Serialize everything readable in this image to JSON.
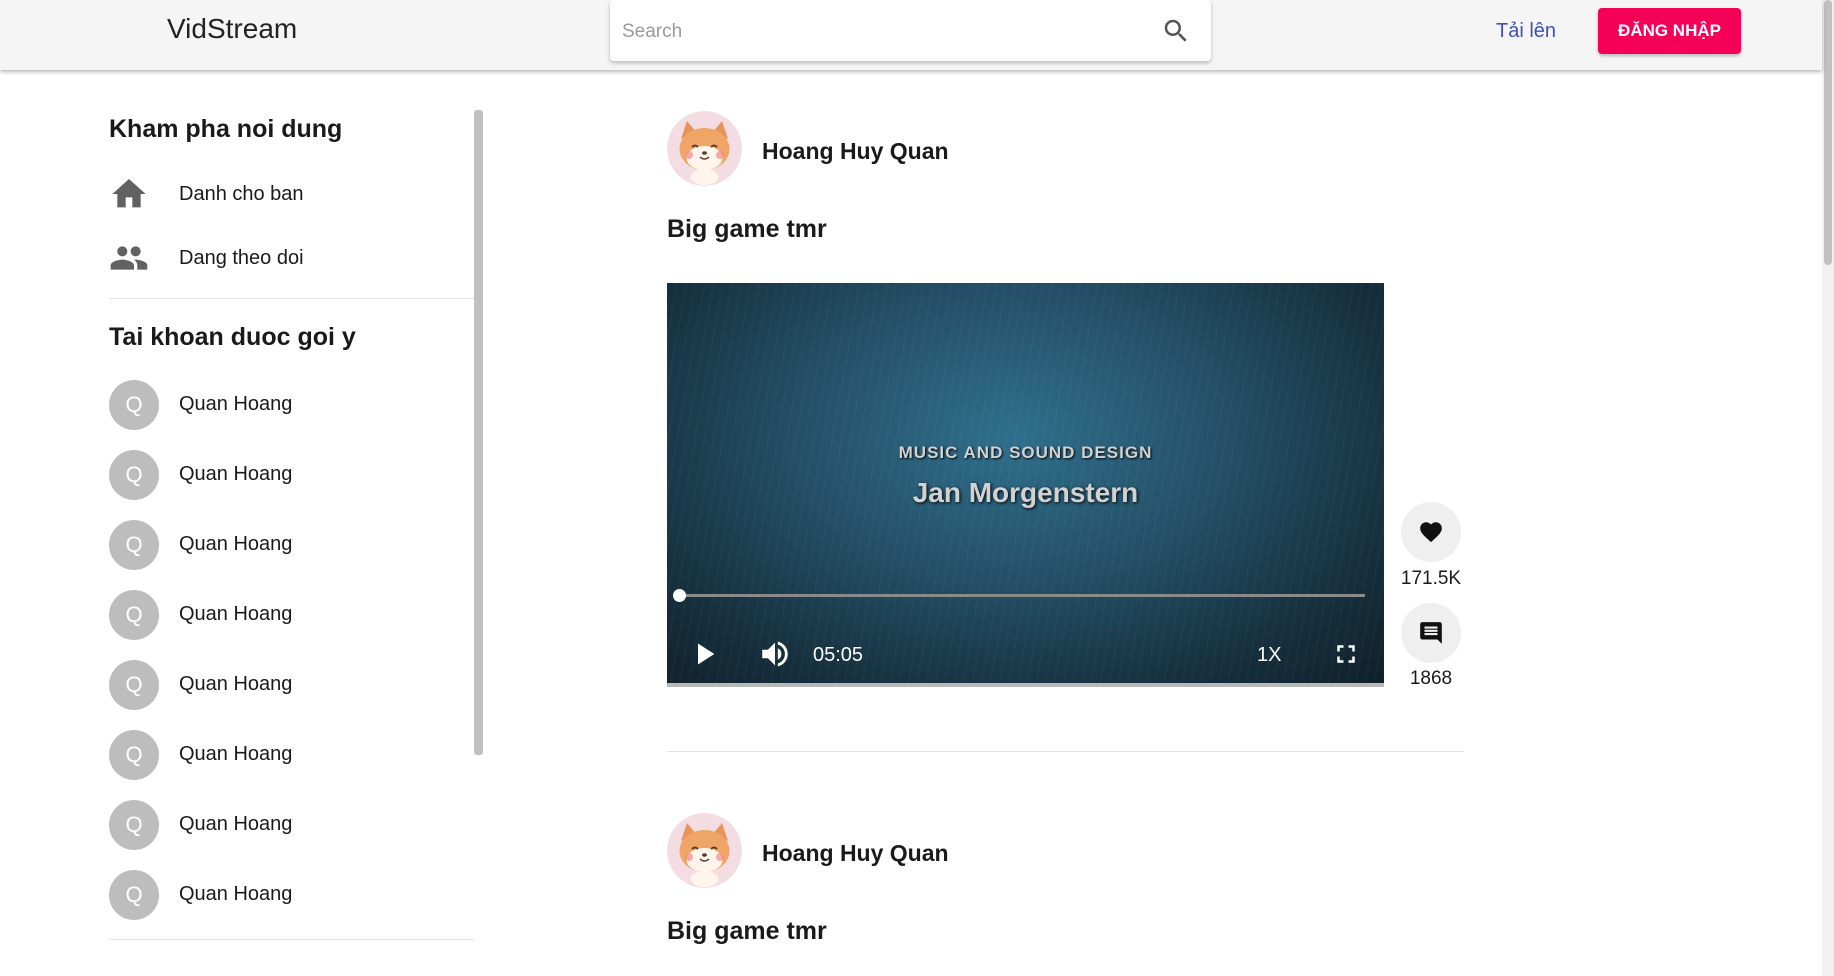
{
  "header": {
    "logo": "VidStream",
    "search_placeholder": "Search",
    "upload_label": "Tải lên",
    "login_label": "ĐĂNG NHẬP",
    "icons": {
      "search": "search-icon"
    }
  },
  "sidebar": {
    "discover_title": "Kham pha noi dung",
    "nav": [
      {
        "label": "Danh cho ban",
        "icon": "home-icon"
      },
      {
        "label": "Dang theo doi",
        "icon": "people-icon"
      }
    ],
    "suggested_title": "Tai khoan duoc goi y",
    "accounts": [
      {
        "initial": "Q",
        "name": "Quan Hoang"
      },
      {
        "initial": "Q",
        "name": "Quan Hoang"
      },
      {
        "initial": "Q",
        "name": "Quan Hoang"
      },
      {
        "initial": "Q",
        "name": "Quan Hoang"
      },
      {
        "initial": "Q",
        "name": "Quan Hoang"
      },
      {
        "initial": "Q",
        "name": "Quan Hoang"
      },
      {
        "initial": "Q",
        "name": "Quan Hoang"
      },
      {
        "initial": "Q",
        "name": "Quan Hoang"
      }
    ]
  },
  "feed": {
    "posts": [
      {
        "author": "Hoang Huy Quan",
        "caption": "Big game tmr",
        "video": {
          "overlay_subtitle": "MUSIC AND SOUND DESIGN",
          "overlay_title": "Jan Morgenstern",
          "time": "05:05",
          "speed": "1X",
          "progress": 0
        },
        "likes": "171.5K",
        "comments": "1868"
      },
      {
        "author": "Hoang Huy Quan",
        "caption": "Big game tmr"
      }
    ]
  },
  "colors": {
    "accent": "#f50057",
    "link": "#3f51b5",
    "header_bg": "#f5f5f5",
    "avatar_placeholder": "#bdbdbd"
  }
}
